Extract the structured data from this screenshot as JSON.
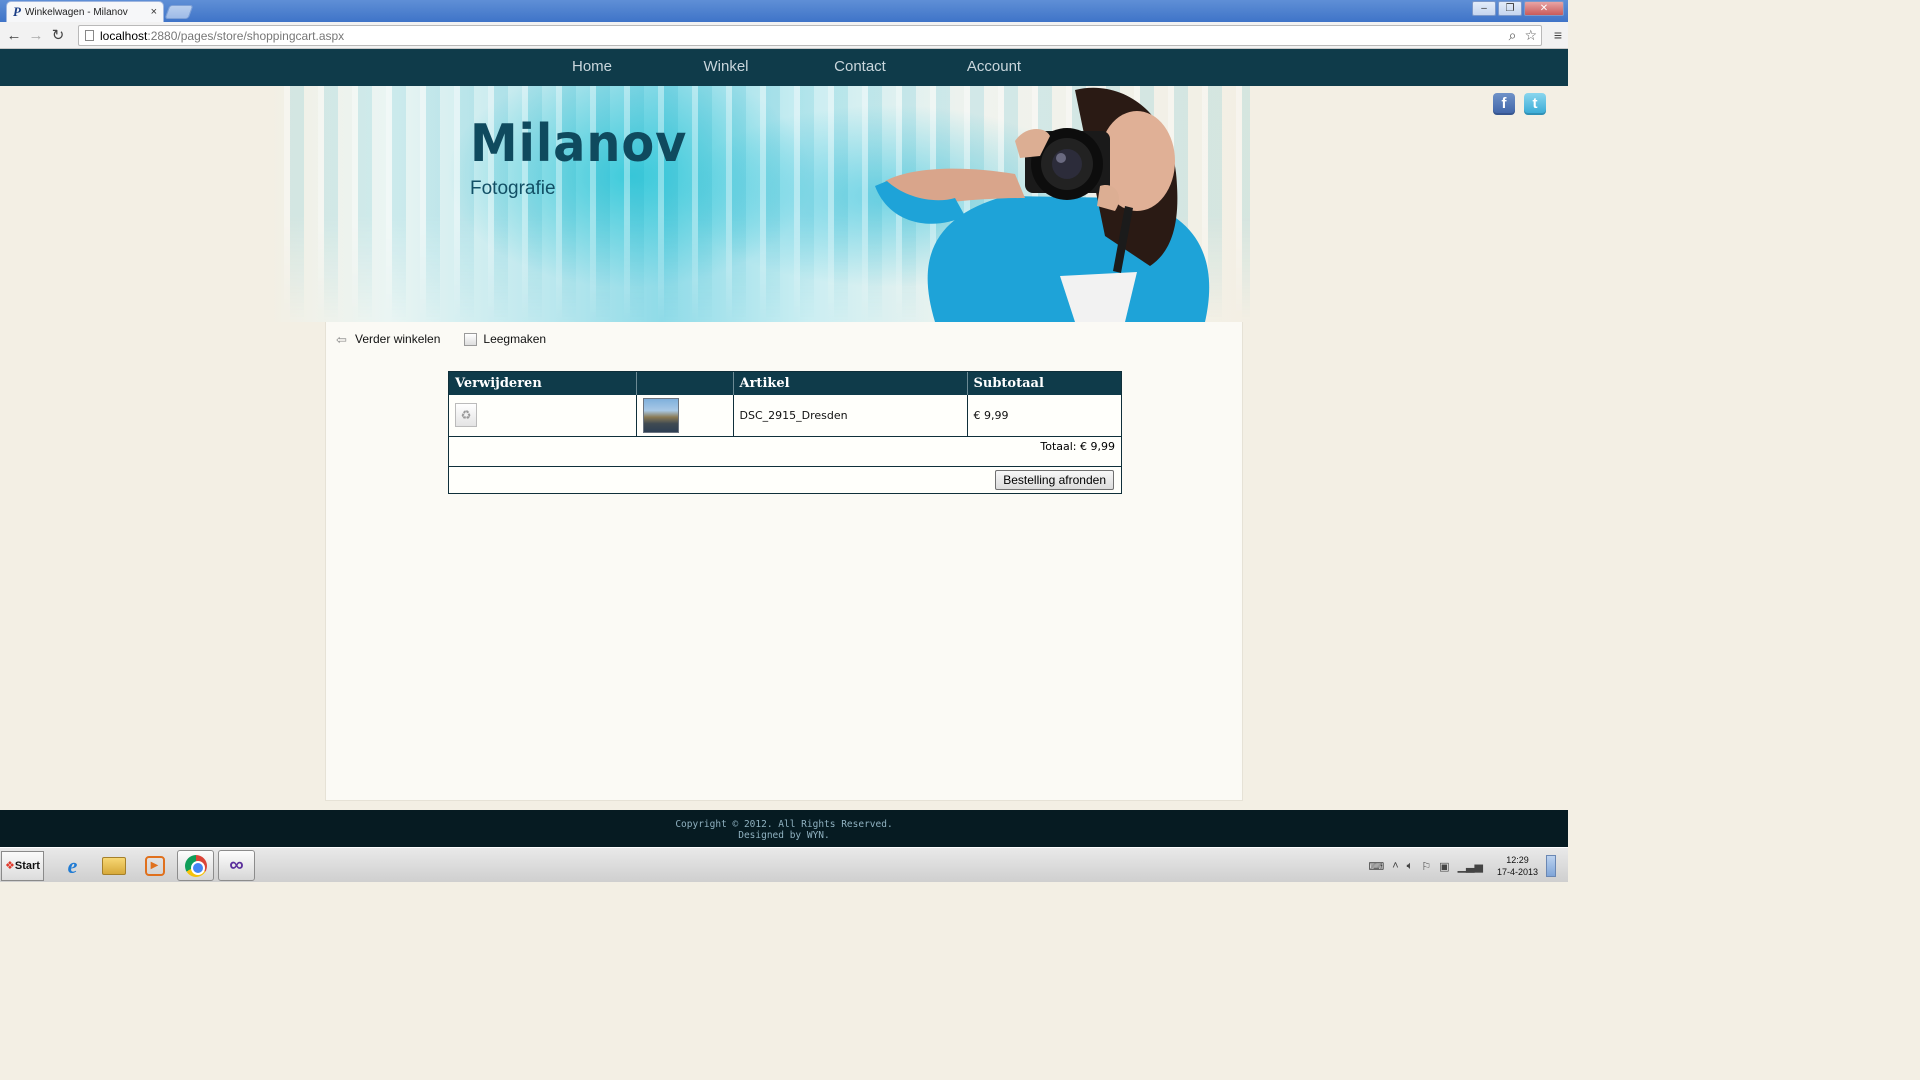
{
  "browser": {
    "tab_title": "Winkelwagen - Milanov",
    "tab_favicon": "P",
    "tab_close": "×",
    "url_host": "localhost",
    "url_path": ":2880/pages/store/shoppingcart.aspx",
    "window_controls": {
      "minimize": "–",
      "restore": "❐",
      "close": "✕"
    },
    "nav": {
      "back": "←",
      "forward": "→",
      "reload": "↻"
    },
    "omnibox_icons": {
      "zoom": "⌕",
      "bookmark": "☆"
    },
    "menu": "≡"
  },
  "site": {
    "nav": [
      "Home",
      "Winkel",
      "Contact",
      "Account"
    ],
    "brand": {
      "title": "Milanov",
      "subtitle": "Fotografie"
    },
    "social": {
      "facebook": "f",
      "twitter": "t"
    },
    "colors": {
      "nav_bg": "#0f3b4a",
      "footer_bg": "#061b22",
      "accent": "#0f4a5e"
    }
  },
  "cart": {
    "actions": {
      "continue": "Verder winkelen",
      "empty": "Leegmaken"
    },
    "columns": [
      "Verwijderen",
      "",
      "Artikel",
      "Subtotaal"
    ],
    "rows": [
      {
        "article": "DSC_2915_Dresden",
        "subtotal": "€ 9,99"
      }
    ],
    "total": "Totaal: € 9,99",
    "checkout_label": "Bestelling afronden"
  },
  "footer": {
    "line1": "Copyright © 2012. All Rights Reserved.",
    "line2": "Designed by WYN."
  },
  "taskbar": {
    "start_label": "Start",
    "time": "12:29",
    "date": "17-4-2013"
  }
}
